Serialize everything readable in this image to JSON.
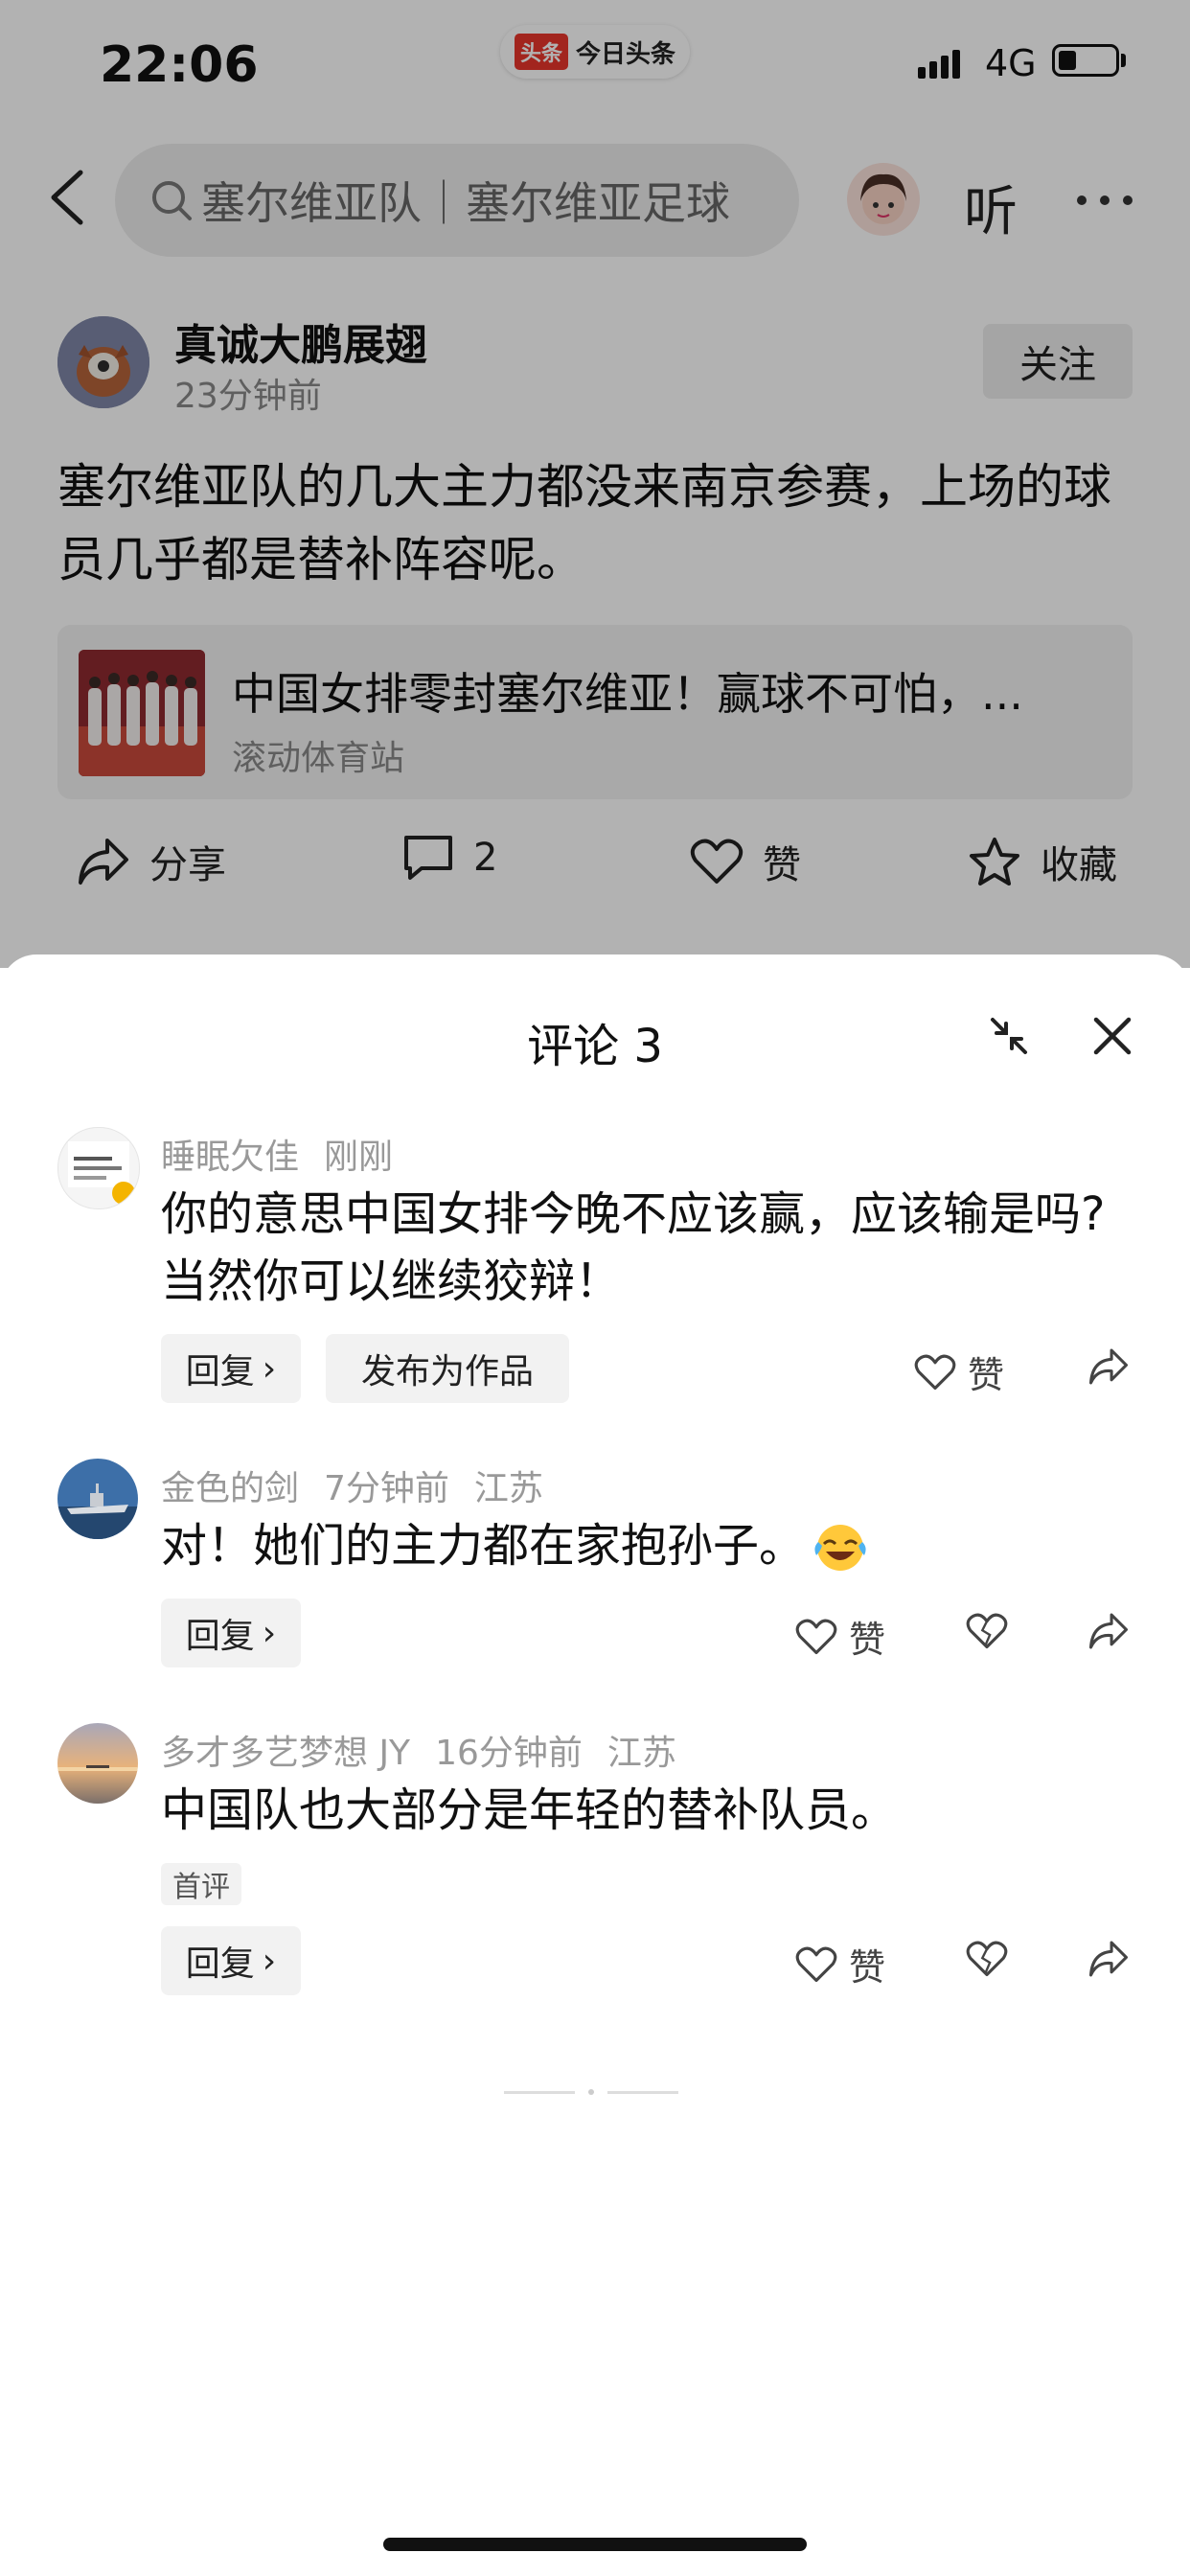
{
  "status_bar": {
    "time": "22:06",
    "app_badge_icon": "头条",
    "app_badge_text": "今日头条",
    "network": "4G"
  },
  "header": {
    "search_text": "塞尔维亚队｜塞尔维亚足球",
    "listen_label": "听"
  },
  "post": {
    "author": "真诚大鹏展翅",
    "time": "23分钟前",
    "follow_label": "关注",
    "text": "塞尔维亚队的几大主力都没来南京参赛，上场的球员几乎都是替补阵容呢。",
    "link": {
      "title": "中国女排零封塞尔维亚！赢球不可怕，...",
      "source": "滚动体育站"
    },
    "actions": {
      "share": "分享",
      "comment_count": "2",
      "like": "赞",
      "favorite": "收藏"
    }
  },
  "comments_sheet": {
    "title": "评论 3",
    "comments": [
      {
        "user": "睡眠欠佳",
        "time": "刚刚",
        "location": "",
        "text_line1": "你的意思中国女排今晚不应该赢，应该输是吗?",
        "text_line2": "当然你可以继续狡辩！",
        "reply_label": "回复",
        "publish_label": "发布为作品",
        "like_label": "赞"
      },
      {
        "user": "金色的剑",
        "time": "7分钟前",
        "location": "江苏",
        "text": "对！她们的主力都在家抱孙子。",
        "reply_label": "回复",
        "like_label": "赞"
      },
      {
        "user": "多才多艺梦想 JY",
        "time": "16分钟前",
        "location": "江苏",
        "text": "中国队也大部分是年轻的替补队员。",
        "tag": "首评",
        "reply_label": "回复",
        "like_label": "赞"
      }
    ]
  },
  "colors": {
    "accent_red": "#e8352b",
    "overlay": "rgba(0,0,0,0.30)",
    "pill_bg": "#f2f2f2"
  }
}
